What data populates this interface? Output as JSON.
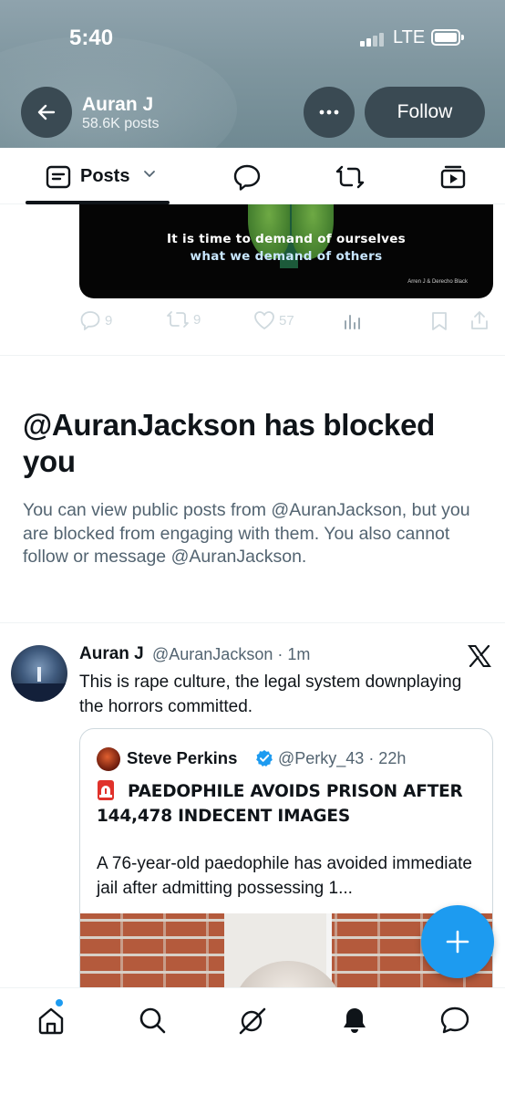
{
  "status_bar": {
    "time": "5:40",
    "network": "LTE"
  },
  "profile_header": {
    "name": "Auran J",
    "post_count": "58.6K posts",
    "follow_label": "Follow"
  },
  "tabs": {
    "posts_label": "Posts",
    "icons": [
      "posts-icon",
      "replies-icon",
      "retweet-icon",
      "media-icon"
    ]
  },
  "pinned_media": {
    "line1": "It is time to demand of ourselves",
    "line2": "what we demand of others",
    "credit": "Arren J & Derecho Black",
    "replies": "9",
    "retweets": "9",
    "likes": "57"
  },
  "blocked_notice": {
    "title": "@AuranJackson has blocked you",
    "body": "You can view public posts from @AuranJackson, but you are blocked from engaging with them. You also cannot follow or message @AuranJackson."
  },
  "tweet": {
    "author": "Auran J",
    "handle_time": "@AuranJackson · 1m",
    "text": "This is rape culture, the legal system downplaying the horrors committed.",
    "quote": {
      "author": "Steve Perkins",
      "handle_time": "@Perky_43 · 22h",
      "headline": "PAEDOPHILE AVOIDS PRISON AFTER 144,478 INDECENT IMAGES",
      "body": "A 76-year-old paedophile has avoided immediate jail after admitting possessing 1..."
    }
  },
  "colors": {
    "accent": "#1d9bf0",
    "header_bg": "#7f969f",
    "header_button": "#3a4a53",
    "secondary_text": "#536471"
  },
  "bottom_nav": [
    "home-icon",
    "search-icon",
    "grok-icon",
    "notifications-icon",
    "messages-icon"
  ]
}
